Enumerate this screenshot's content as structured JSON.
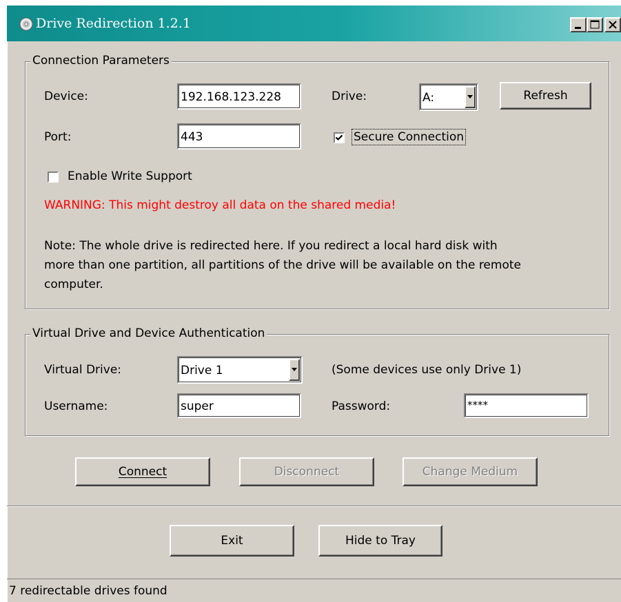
{
  "window": {
    "title": "Drive Redirection 1.2.1",
    "controls": {
      "minimize": "_",
      "maximize": "□",
      "close": "✕"
    }
  },
  "connection_group": {
    "legend": "Connection Parameters",
    "device_label": "Device:",
    "device_value": "192.168.123.228",
    "drive_label": "Drive:",
    "drive_value": "A:",
    "refresh_label": "Refresh",
    "port_label": "Port:",
    "port_value": "443",
    "secure_label": "Secure Connection",
    "secure_checked": true,
    "write_support_label": "Enable Write Support",
    "write_support_checked": false,
    "warning": "WARNING: This might destroy all data on the shared media!",
    "note_lines": [
      "Note: The whole drive is redirected here. If you redirect a local hard disk with",
      "more than one partition, all partitions of the drive will be available on the remote",
      "computer."
    ]
  },
  "auth_group": {
    "legend": "Virtual Drive and Device Authentication",
    "virtual_drive_label": "Virtual Drive:",
    "virtual_drive_value": "Drive 1",
    "virtual_drive_hint": "(Some devices use only Drive 1)",
    "username_label": "Username:",
    "username_value": "super",
    "password_label": "Password:",
    "password_value": "****"
  },
  "actions": {
    "connect": "Connect",
    "disconnect": "Disconnect",
    "change_medium": "Change Medium",
    "exit": "Exit",
    "hide_to_tray": "Hide to Tray"
  },
  "status": "7 redirectable drives found",
  "colors": {
    "title_bar_start": "#0f8c8c",
    "title_bar_end": "#7fd0d0",
    "dialog_face": "#d4d0c8",
    "warning_text": "#ff0000"
  },
  "icons": {
    "app": "cd-disc-icon",
    "dropdown": "chevron-down-icon",
    "checkmark": "check-icon"
  }
}
